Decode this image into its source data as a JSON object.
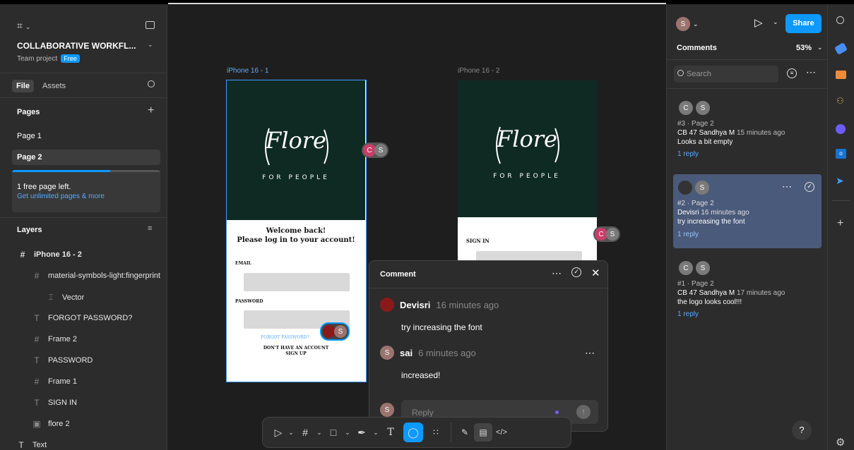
{
  "file": {
    "title": "COLLABORATIVE WORKFL...",
    "subtitle": "Team project",
    "plan_badge": "Free"
  },
  "left_tabs": {
    "file": "File",
    "assets": "Assets"
  },
  "pages": {
    "header": "Pages",
    "items": [
      "Page 1",
      "Page 2"
    ],
    "notice": "1 free page left.",
    "upgrade_link": "Get unlimited pages & more",
    "progress": 0.5
  },
  "layers": {
    "header": "Layers",
    "items": [
      "iPhone 16 - 2",
      "material-symbols-light:fingerprint",
      "Vector",
      "FORGOT PASSWORD?",
      "Frame 2",
      "PASSWORD",
      "Frame 1",
      "SIGN IN",
      "flore 2",
      "Text"
    ]
  },
  "canvas": {
    "frame1_label": "iPhone 16 - 1",
    "frame2_label": "iPhone 16 - 2",
    "logo_word": "Flore",
    "logo_arc": "FOR PEOPLE",
    "welcome": "Welcome back!",
    "login_prompt": "Please log in to your account!",
    "email_label": "EMAIL",
    "password_label": "PASSWORD",
    "forgot": "FORGOT PASSWORD?",
    "no_account": "DON'T HAVE AN ACCOUNT",
    "sign_up": "SIGN UP",
    "sign_in": "SIGN IN"
  },
  "avatars": {
    "c": "C",
    "s": "S"
  },
  "comment_popup": {
    "title": "Comment",
    "first_author": "Devisri",
    "first_time": "16 minutes ago",
    "first_text": "try increasing the font",
    "second_author": "sai",
    "second_time": "6 minutes ago",
    "second_text": "increased!",
    "reply_placeholder": "Reply"
  },
  "right_panel": {
    "share": "Share",
    "comments": "Comments",
    "zoom": "53%",
    "search_placeholder": "Search",
    "threads": [
      {
        "meta": "#3 · Page 2",
        "author": "CB 47 Sandhya M",
        "time": "15 minutes ago",
        "text": "Looks a bit empty",
        "replies": "1 reply"
      },
      {
        "meta": "#2 · Page 2",
        "author": "Devisri",
        "time": "16 minutes ago",
        "text": "try increasing the font",
        "replies": "1 reply"
      },
      {
        "meta": "#1 · Page 2",
        "author": "CB 47 Sandhya M",
        "time": "17 minutes ago",
        "text": "the logo looks cool!!!",
        "replies": "1 reply"
      }
    ],
    "help": "?"
  },
  "colors": {
    "accent": "#0d99ff",
    "selected_thread": "#4a5a7a",
    "frame_dark": "#0f2a22",
    "link_blue": "#5aa8ff"
  }
}
